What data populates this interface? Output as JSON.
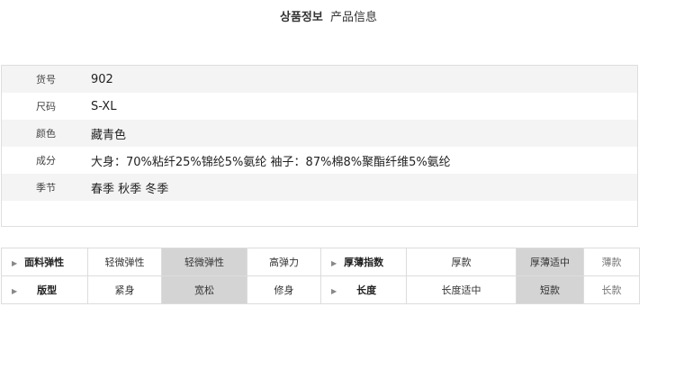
{
  "header": {
    "title_ko": "상품정보",
    "title_cn": "产品信息"
  },
  "info": {
    "rows": [
      {
        "label": "货号",
        "value": "902"
      },
      {
        "label": "尺码",
        "value": "S-XL"
      },
      {
        "label": "颜色",
        "value": "藏青色"
      },
      {
        "label": "成分",
        "value": "大身：70%粘纤25%锦纶5%氨纶 袖子：87%棉8%聚酯纤维5%氨纶"
      },
      {
        "label": "季节",
        "value": "春季 秋季 冬季"
      }
    ]
  },
  "attributes": {
    "row1": {
      "label_a": "面料弹性",
      "opts_a": [
        "轻微弹性",
        "轻微弹性",
        "高弹力"
      ],
      "label_b": "厚薄指数",
      "opts_b": [
        "厚款",
        "厚薄适中",
        "薄款"
      ]
    },
    "row2": {
      "label_a": "版型",
      "opts_a": [
        "紧身",
        "宽松",
        "修身"
      ],
      "label_b": "长度",
      "opts_b": [
        "长度适中",
        "短款",
        "长款"
      ]
    }
  },
  "colors": {
    "selected_bg": "#d4d4d4",
    "alt_row_bg": "#f4f4f4",
    "border": "#dcdcdc"
  }
}
